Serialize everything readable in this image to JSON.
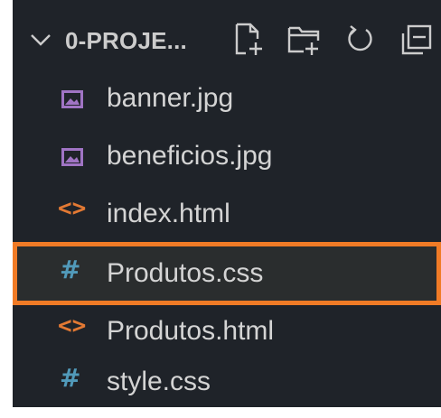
{
  "explorer": {
    "folder_name": "0-PROJE...",
    "actions": [
      {
        "icon": "new-file-icon"
      },
      {
        "icon": "new-folder-icon"
      },
      {
        "icon": "refresh-icon"
      },
      {
        "icon": "collapse-all-icon"
      }
    ],
    "files": [
      {
        "name": "banner.jpg",
        "icon": "image-file-icon"
      },
      {
        "name": "beneficios.jpg",
        "icon": "image-file-icon"
      },
      {
        "name": "index.html",
        "icon": "html-file-icon",
        "glyph": "<>"
      },
      {
        "name": "Produtos.css",
        "icon": "css-file-icon",
        "glyph": "#"
      },
      {
        "name": "Produtos.html",
        "icon": "html-file-icon",
        "glyph": "<>"
      },
      {
        "name": "style.css",
        "icon": "css-file-icon",
        "glyph": "#"
      }
    ],
    "colors": {
      "background": "#1f2329",
      "image_icon": "#a074c4",
      "html_icon": "#e37933",
      "css_icon": "#519aba",
      "highlight": "#f07b26"
    }
  }
}
